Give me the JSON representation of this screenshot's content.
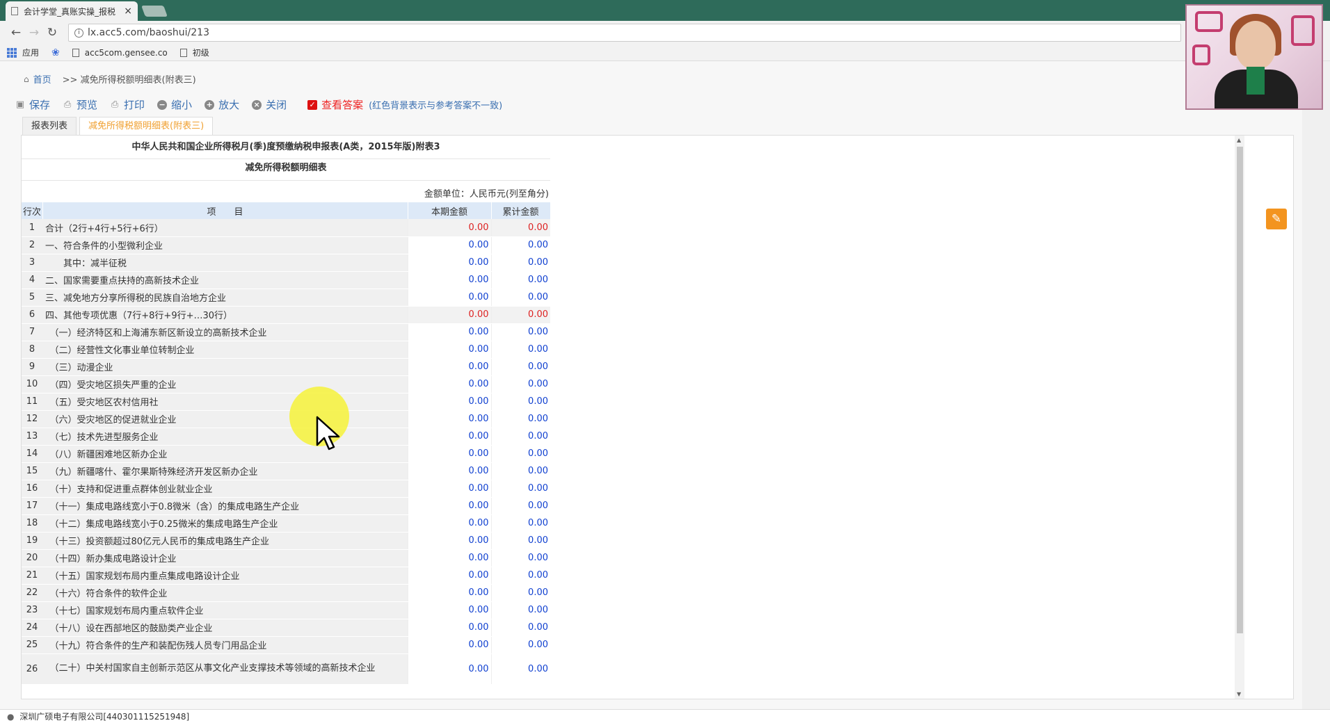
{
  "browser": {
    "tab_title": "会计学堂_真账实操_报税",
    "tab_close": "×",
    "url": "lx.acc5.com/baoshui/213",
    "bookmarks": [
      "应用",
      "acc5com.gensee.co",
      "初级"
    ]
  },
  "breadcrumb": {
    "home": "首页",
    "current": ">> 减免所得税额明细表(附表三)"
  },
  "toolbar": {
    "save": "保存",
    "preview": "预览",
    "print": "打印",
    "zoom_out": "缩小",
    "zoom_in": "放大",
    "close": "关闭",
    "check_answer": "查看答案",
    "hint": "(红色背景表示与参考答案不一致)"
  },
  "subtabs": [
    "报表列表",
    "减免所得税额明细表(附表三)"
  ],
  "form": {
    "title": "中华人民共和国企业所得税月(季)度预缴纳税申报表(A类，2015年版)附表3",
    "subtitle": "减免所得税额明细表",
    "unit": "金额单位：人民币元(列至角分)",
    "headers": [
      "行次",
      "项　　目",
      "本期金额",
      "累计金额"
    ],
    "rows": [
      {
        "no": "1",
        "item": "合计（2行+4行+5行+6行）",
        "cur": "0.00",
        "cum": "0.00",
        "red": true
      },
      {
        "no": "2",
        "item": "一、符合条件的小型微利企业",
        "cur": "0.00",
        "cum": "0.00",
        "red": false
      },
      {
        "no": "3",
        "item": "　　其中：减半征税",
        "cur": "0.00",
        "cum": "0.00",
        "red": false
      },
      {
        "no": "4",
        "item": "二、国家需要重点扶持的高新技术企业",
        "cur": "0.00",
        "cum": "0.00",
        "red": false
      },
      {
        "no": "5",
        "item": "三、减免地方分享所得税的民族自治地方企业",
        "cur": "0.00",
        "cum": "0.00",
        "red": false
      },
      {
        "no": "6",
        "item": "四、其他专项优惠（7行+8行+9行+…30行）",
        "cur": "0.00",
        "cum": "0.00",
        "red": true
      },
      {
        "no": "7",
        "item": "　（一）经济特区和上海浦东新区新设立的高新技术企业",
        "cur": "0.00",
        "cum": "0.00",
        "red": false
      },
      {
        "no": "8",
        "item": "　（二）经营性文化事业单位转制企业",
        "cur": "0.00",
        "cum": "0.00",
        "red": false
      },
      {
        "no": "9",
        "item": "　（三）动漫企业",
        "cur": "0.00",
        "cum": "0.00",
        "red": false
      },
      {
        "no": "10",
        "item": "　（四）受灾地区损失严重的企业",
        "cur": "0.00",
        "cum": "0.00",
        "red": false
      },
      {
        "no": "11",
        "item": "　（五）受灾地区农村信用社",
        "cur": "0.00",
        "cum": "0.00",
        "red": false
      },
      {
        "no": "12",
        "item": "　（六）受灾地区的促进就业企业",
        "cur": "0.00",
        "cum": "0.00",
        "red": false
      },
      {
        "no": "13",
        "item": "　（七）技术先进型服务企业",
        "cur": "0.00",
        "cum": "0.00",
        "red": false
      },
      {
        "no": "14",
        "item": "　（八）新疆困难地区新办企业",
        "cur": "0.00",
        "cum": "0.00",
        "red": false
      },
      {
        "no": "15",
        "item": "　（九）新疆喀什、霍尔果斯特殊经济开发区新办企业",
        "cur": "0.00",
        "cum": "0.00",
        "red": false
      },
      {
        "no": "16",
        "item": "　（十）支持和促进重点群体创业就业企业",
        "cur": "0.00",
        "cum": "0.00",
        "red": false
      },
      {
        "no": "17",
        "item": "　（十一）集成电路线宽小于0.8微米（含）的集成电路生产企业",
        "cur": "0.00",
        "cum": "0.00",
        "red": false
      },
      {
        "no": "18",
        "item": "　（十二）集成电路线宽小于0.25微米的集成电路生产企业",
        "cur": "0.00",
        "cum": "0.00",
        "red": false
      },
      {
        "no": "19",
        "item": "　（十三）投资额超过80亿元人民币的集成电路生产企业",
        "cur": "0.00",
        "cum": "0.00",
        "red": false
      },
      {
        "no": "20",
        "item": "　（十四）新办集成电路设计企业",
        "cur": "0.00",
        "cum": "0.00",
        "red": false
      },
      {
        "no": "21",
        "item": "　（十五）国家规划布局内重点集成电路设计企业",
        "cur": "0.00",
        "cum": "0.00",
        "red": false
      },
      {
        "no": "22",
        "item": "　（十六）符合条件的软件企业",
        "cur": "0.00",
        "cum": "0.00",
        "red": false
      },
      {
        "no": "23",
        "item": "　（十七）国家规划布局内重点软件企业",
        "cur": "0.00",
        "cum": "0.00",
        "red": false
      },
      {
        "no": "24",
        "item": "　（十八）设在西部地区的鼓励类产业企业",
        "cur": "0.00",
        "cum": "0.00",
        "red": false
      },
      {
        "no": "25",
        "item": "　（十九）符合条件的生产和装配伤残人员专门用品企业",
        "cur": "0.00",
        "cum": "0.00",
        "red": false
      },
      {
        "no": "26",
        "item": "　（二十）中关村国家自主创新示范区从事文化产业支撑技术等领域的高新技术企业",
        "cur": "0.00",
        "cum": "0.00",
        "red": false,
        "tall": true
      }
    ]
  },
  "status": {
    "company": "深圳广硕电子有限公司[440301115251948]"
  }
}
